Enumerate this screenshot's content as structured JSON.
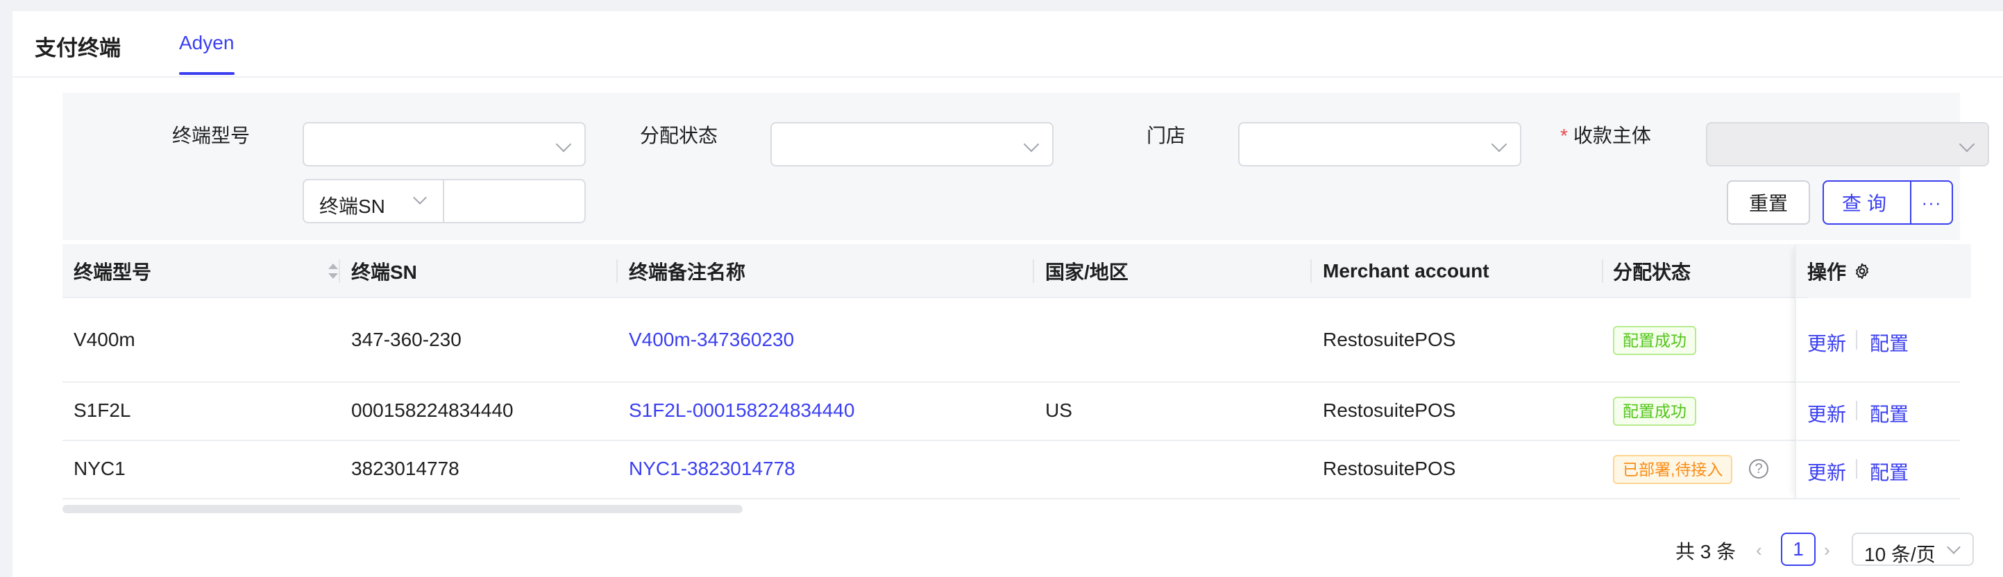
{
  "header": {
    "title": "支付终端",
    "tabs": [
      {
        "label": "Adyen",
        "active": true
      }
    ]
  },
  "filters": {
    "terminal_model": {
      "label": "终端型号",
      "value": ""
    },
    "assign_status": {
      "label": "分配状态",
      "value": ""
    },
    "store": {
      "label": "门店",
      "value": ""
    },
    "payee": {
      "label": "收款主体",
      "required_mark": "*",
      "value": "",
      "disabled": true
    },
    "sn_search": {
      "type_selected": "终端SN",
      "value": ""
    },
    "reset_label": "重置",
    "query_label": "查询",
    "more_label": "···"
  },
  "table": {
    "columns": [
      "终端型号",
      "终端SN",
      "终端备注名称",
      "国家/地区",
      "Merchant account",
      "分配状态",
      "操作"
    ],
    "rows": [
      {
        "model": "V400m",
        "sn": "347-360-230",
        "name": "V400m-347360230",
        "country": "",
        "merchant": "RestosuitePOS",
        "status": "配置成功",
        "status_type": "success",
        "update": "更新",
        "config": "配置"
      },
      {
        "model": "S1F2L",
        "sn": "000158224834440",
        "name": "S1F2L-000158224834440",
        "country": "US",
        "merchant": "RestosuitePOS",
        "status": "配置成功",
        "status_type": "success",
        "update": "更新",
        "config": "配置"
      },
      {
        "model": "NYC1",
        "sn": "3823014778",
        "name": "NYC1-3823014778",
        "country": "",
        "merchant": "RestosuitePOS",
        "status": "已部署,待接入",
        "status_type": "warning",
        "help": "?",
        "update": "更新",
        "config": "配置"
      }
    ]
  },
  "pagination": {
    "total_text": "共 3 条",
    "current_page": "1",
    "page_size": "10 条/页",
    "prev": "‹",
    "next": "›"
  },
  "colors": {
    "accent": "#3b3ff0",
    "success": "#52c41a",
    "warning": "#fa8c16",
    "required": "#e5484d"
  }
}
